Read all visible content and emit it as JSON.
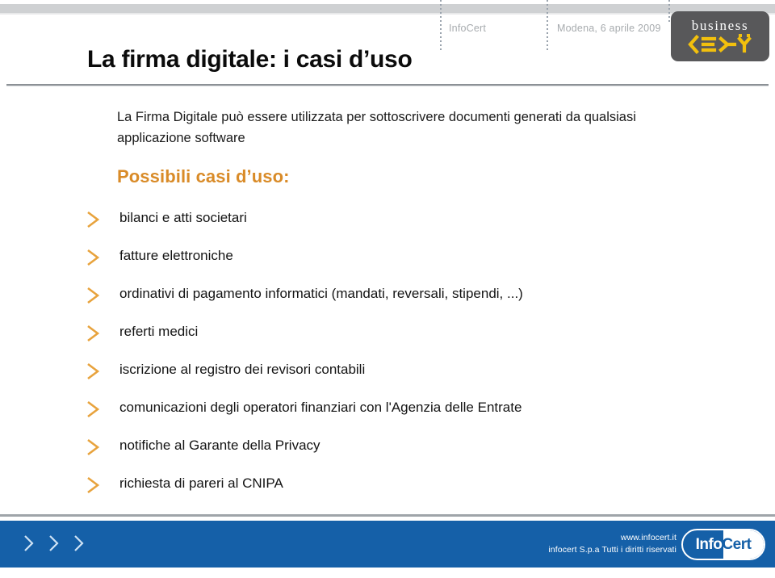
{
  "header": {
    "org": "InfoCert",
    "event": "Modena, 6 aprile 2009",
    "logo": {
      "line1": "business",
      "line2": "KEY"
    }
  },
  "title": "La firma digitale: i casi d’uso",
  "intro": "La Firma Digitale può essere utilizzata per sottoscrivere documenti generati da qualsiasi applicazione software",
  "subhead": "Possibili casi d’uso:",
  "bullets": [
    {
      "text": "bilanci e atti societari"
    },
    {
      "text": "fatture elettroniche"
    },
    {
      "text": "ordinativi di pagamento informatici (mandati, reversali, stipendi, ...)"
    },
    {
      "text": "referti medici"
    },
    {
      "text": "iscrizione al registro dei revisori contabili"
    },
    {
      "text": "comunicazioni degli operatori finanziari con l'Agenzia delle Entrate"
    },
    {
      "text": "notifiche al Garante della Privacy"
    },
    {
      "text": "richiesta di pareri al CNIPA"
    }
  ],
  "footer": {
    "website": "www.infocert.it",
    "copyright": "infocert S.p.a Tutti i diritti riservati",
    "logo": {
      "part1": "Info",
      "part2": "Cert"
    }
  },
  "colors": {
    "accent_orange": "#d98b28",
    "bullet_chevron": "#e8a33d",
    "footer_blue": "#1560a8",
    "top_band_gray": "#cfd1d3",
    "logo_gray": "#58585a",
    "logo_yellow": "#f2c00d",
    "meta_gray": "#a7abae"
  }
}
